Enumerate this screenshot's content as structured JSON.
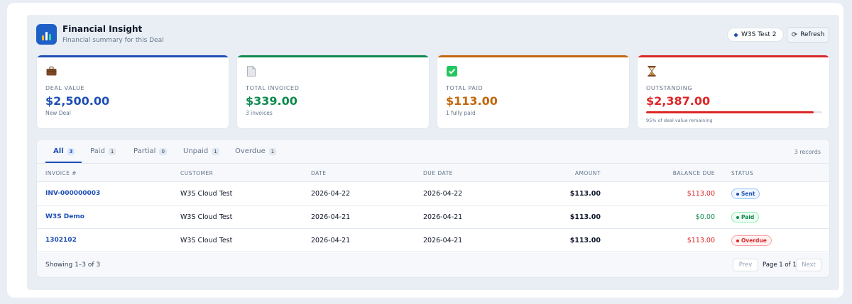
{
  "header": {
    "title": "Financial Insight",
    "subtitle": "Financial summary for this Deal",
    "deal_pill": "W3S Test 2",
    "refresh_label": "Refresh"
  },
  "cards": [
    {
      "icon": "briefcase-icon",
      "label": "DEAL VALUE",
      "value": "$2,500.00",
      "sub": "New Deal",
      "color": "#1e4fb4"
    },
    {
      "icon": "document-icon",
      "label": "TOTAL INVOICED",
      "value": "$339.00",
      "sub": "3 invoices",
      "color": "#0f8a4f"
    },
    {
      "icon": "check-icon",
      "label": "TOTAL PAID",
      "value": "$113.00",
      "sub": "1 fully paid",
      "color": "#c2680d"
    },
    {
      "icon": "hourglass-icon",
      "label": "OUTSTANDING",
      "value": "$2,387.00",
      "sub": "95% of deal value remaining",
      "color": "#dc2626",
      "progress": 0.95
    }
  ],
  "tabs": [
    {
      "label": "All",
      "count": "3"
    },
    {
      "label": "Paid",
      "count": "1"
    },
    {
      "label": "Partial",
      "count": "0"
    },
    {
      "label": "Unpaid",
      "count": "1"
    },
    {
      "label": "Overdue",
      "count": "1"
    }
  ],
  "records_label": "3 records",
  "columns": [
    "INVOICE #",
    "CUSTOMER",
    "DATE",
    "DUE DATE",
    "AMOUNT",
    "BALANCE DUE",
    "STATUS"
  ],
  "rows": [
    {
      "invoice": "INV-000000003",
      "customer": "W3S Cloud Test",
      "date": "2026-04-22",
      "due": "2026-04-22",
      "amount": "$113.00",
      "balance": "$113.00",
      "status": "Sent"
    },
    {
      "invoice": "W3S Demo",
      "customer": "W3S Cloud Test",
      "date": "2026-04-21",
      "due": "2026-04-21",
      "amount": "$113.00",
      "balance": "$0.00",
      "status": "Paid"
    },
    {
      "invoice": "1302102",
      "customer": "W3S Cloud Test",
      "date": "2026-04-21",
      "due": "2026-04-21",
      "amount": "$113.00",
      "balance": "$113.00",
      "status": "Overdue"
    }
  ],
  "footer": {
    "showing": "Showing 1–3 of 3",
    "prev": "Prev",
    "page_info": "Page 1 of 1",
    "next": "Next"
  },
  "colors": {
    "accent": "#1e4fb4",
    "sent": "#1e4fb4",
    "paid": "#0f8a4f",
    "overdue": "#dc2626"
  }
}
